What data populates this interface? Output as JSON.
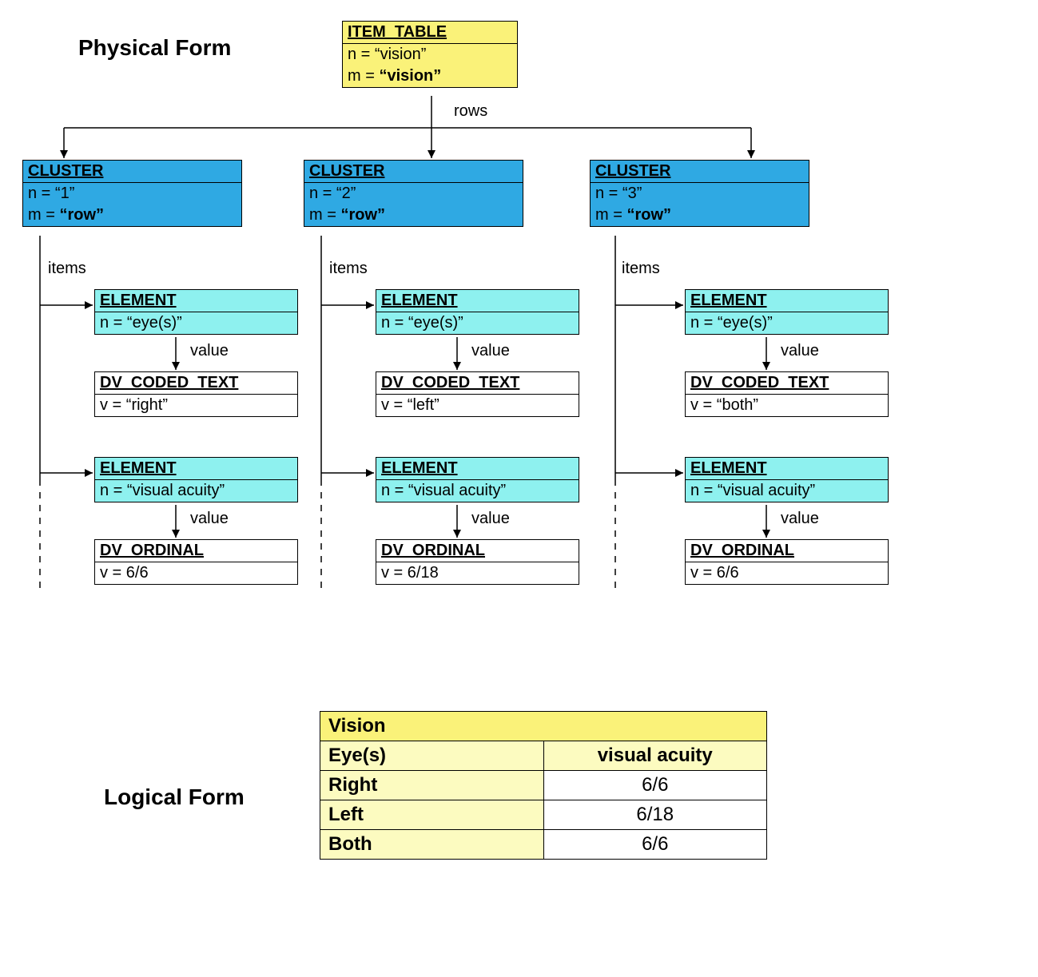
{
  "labels": {
    "physical": "Physical Form",
    "logical": "Logical Form",
    "rows": "rows",
    "items": "items",
    "value": "value"
  },
  "root": {
    "type": "ITEM_TABLE",
    "n": "n = “vision”",
    "m_pref": "m = ",
    "m_val": "“vision”"
  },
  "clusters": [
    {
      "type": "CLUSTER",
      "n": "n = “1”",
      "m_pref": "m = ",
      "m_val": "“row”"
    },
    {
      "type": "CLUSTER",
      "n": "n = “2”",
      "m_pref": "m = ",
      "m_val": "“row”"
    },
    {
      "type": "CLUSTER",
      "n": "n = “3”",
      "m_pref": "m = ",
      "m_val": "“row”"
    }
  ],
  "elems": {
    "c0e1": {
      "type": "ELEMENT",
      "n": "n = “eye(s)”"
    },
    "c0v1": {
      "type": "DV_CODED_TEXT",
      "v": "v = “right”"
    },
    "c0e2": {
      "type": "ELEMENT",
      "n": "n = “visual acuity”"
    },
    "c0v2": {
      "type": "DV_ORDINAL",
      "v": "v = 6/6"
    },
    "c1e1": {
      "type": "ELEMENT",
      "n": "n = “eye(s)”"
    },
    "c1v1": {
      "type": "DV_CODED_TEXT",
      "v": "v = “left”"
    },
    "c1e2": {
      "type": "ELEMENT",
      "n": "n = “visual acuity”"
    },
    "c1v2": {
      "type": "DV_ORDINAL",
      "v": "v = 6/18"
    },
    "c2e1": {
      "type": "ELEMENT",
      "n": "n = “eye(s)”"
    },
    "c2v1": {
      "type": "DV_CODED_TEXT",
      "v": "v = “both”"
    },
    "c2e2": {
      "type": "ELEMENT",
      "n": "n = “visual acuity”"
    },
    "c2v2": {
      "type": "DV_ORDINAL",
      "v": "v = 6/6"
    }
  },
  "table": {
    "title": "Vision",
    "col1": "Eye(s)",
    "col2": "visual acuity",
    "rows": [
      {
        "k": "Right",
        "v": "6/6"
      },
      {
        "k": "Left",
        "v": "6/18"
      },
      {
        "k": "Both",
        "v": "6/6"
      }
    ]
  },
  "colors": {
    "yellow": "#faf279",
    "yellow_light": "#fcfbc0",
    "blue": "#2fa9e3",
    "cyan": "#8ef1ef"
  }
}
